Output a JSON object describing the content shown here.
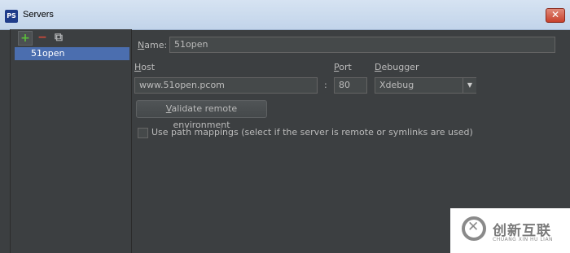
{
  "window": {
    "title": "Servers",
    "app_icon": "PS",
    "close_icon": "close-icon"
  },
  "toolbar": {
    "add_icon": "+",
    "remove_icon": "−",
    "copy_icon": "⧉"
  },
  "servers": [
    {
      "name": "51open"
    }
  ],
  "form": {
    "name_label_mn": "N",
    "name_label_rest": "ame:",
    "name_value": "51open",
    "host_label_mn": "H",
    "host_label_rest": "ost",
    "host_value": "www.51open.pcom",
    "colon": ":",
    "port_label_mn": "P",
    "port_label_rest": "ort",
    "port_value": "80",
    "debugger_label_mn": "D",
    "debugger_label_rest": "ebugger",
    "debugger_value": "Xdebug",
    "validate_mn": "V",
    "validate_rest": "alidate remote environment",
    "path_mappings_label": "Use path mappings (select if the server is remote or symlinks are used)",
    "path_mappings_checked": false
  },
  "watermark": {
    "brand": "创新互联",
    "sub": "CHUANG XIN HU LIAN"
  }
}
